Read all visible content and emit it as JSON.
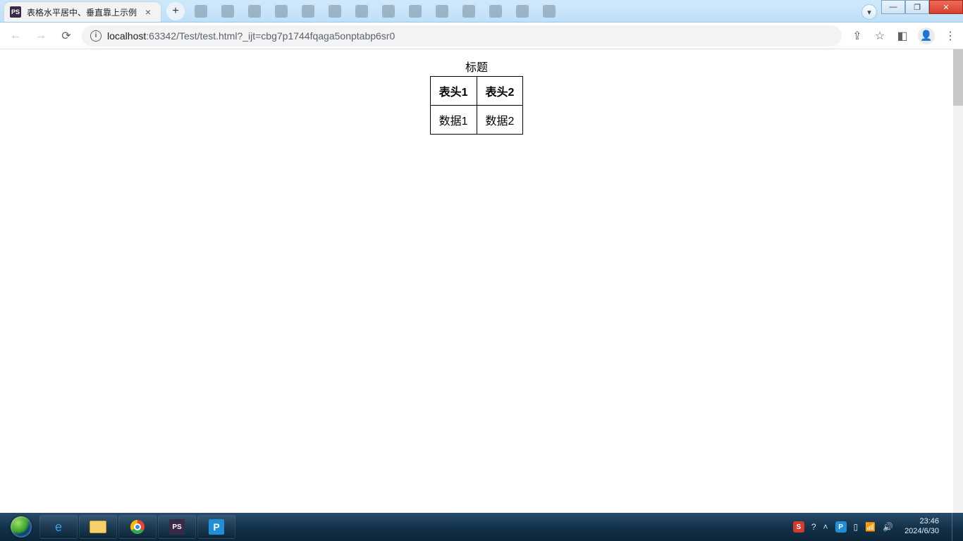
{
  "window": {
    "controls": {
      "min": "—",
      "max": "❐",
      "close": "✕"
    }
  },
  "tab": {
    "favicon": "PS",
    "title": "表格水平居中、垂直靠上示例"
  },
  "toolbar": {
    "url_host": "localhost",
    "url_rest": ":63342/Test/test.html?_ijt=cbg7p1744fqaga5onptabp6sr0"
  },
  "page": {
    "caption": "标题",
    "headers": [
      "表头1",
      "表头2"
    ],
    "rows": [
      [
        "数据1",
        "数据2"
      ]
    ]
  },
  "taskbar": {
    "apps": {
      "ps": "PS",
      "p": "P"
    },
    "tray": {
      "s": "S",
      "p": "P"
    },
    "clock_time": "23:46",
    "clock_date": "2024/6/30"
  }
}
